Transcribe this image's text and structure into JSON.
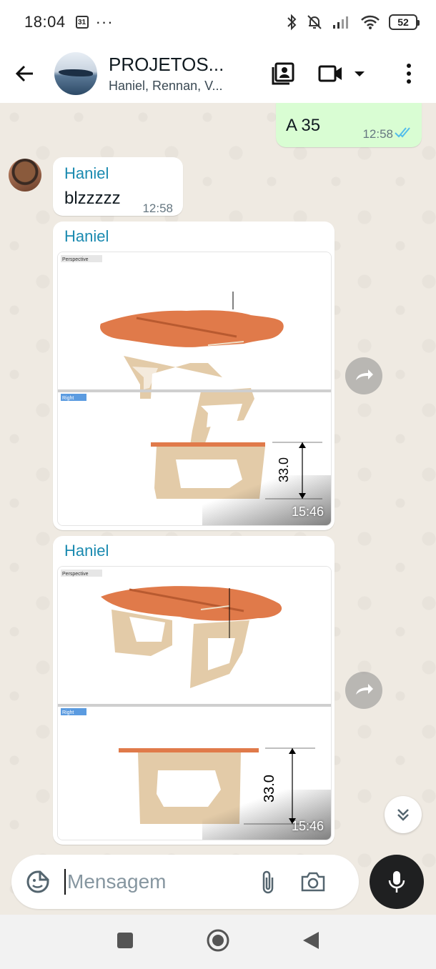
{
  "status_bar": {
    "time": "18:04",
    "calendar_day": "31",
    "more_indicator": "···",
    "battery": "52"
  },
  "header": {
    "title": "PROJETOS...",
    "members": "Haniel, Rennan, V...",
    "icons": [
      "back-arrow-icon",
      "contact-card-icon",
      "video-camera-icon",
      "caret-down-icon",
      "kebab-menu-icon"
    ]
  },
  "messages": [
    {
      "type": "outgoing_text",
      "text": "A 35",
      "time": "12:58",
      "status": "read"
    },
    {
      "type": "incoming_text",
      "sender": "Haniel",
      "text": "blzzzzz",
      "time": "12:58"
    },
    {
      "type": "incoming_image",
      "sender": "Haniel",
      "time": "15:46",
      "viewport_labels": [
        "Perspective",
        "Right"
      ],
      "dimension": "33.0"
    },
    {
      "type": "incoming_image",
      "sender": "Haniel",
      "time": "15:46",
      "viewport_labels": [
        "Perspective",
        "Right"
      ],
      "dimension": "33.0"
    }
  ],
  "composer": {
    "placeholder": "Mensagem",
    "icons": [
      "sticker-icon",
      "attach-icon",
      "camera-icon",
      "mic-icon"
    ]
  },
  "colors": {
    "outgoing_bubble": "#d9fdd3",
    "incoming_bubble": "#ffffff",
    "sender_name": "#1a8ab0",
    "chat_background": "#efeae2",
    "read_ticks": "#53bdeb",
    "tabletop": "#e07a4a",
    "wood_legs": "#e3cba8"
  }
}
